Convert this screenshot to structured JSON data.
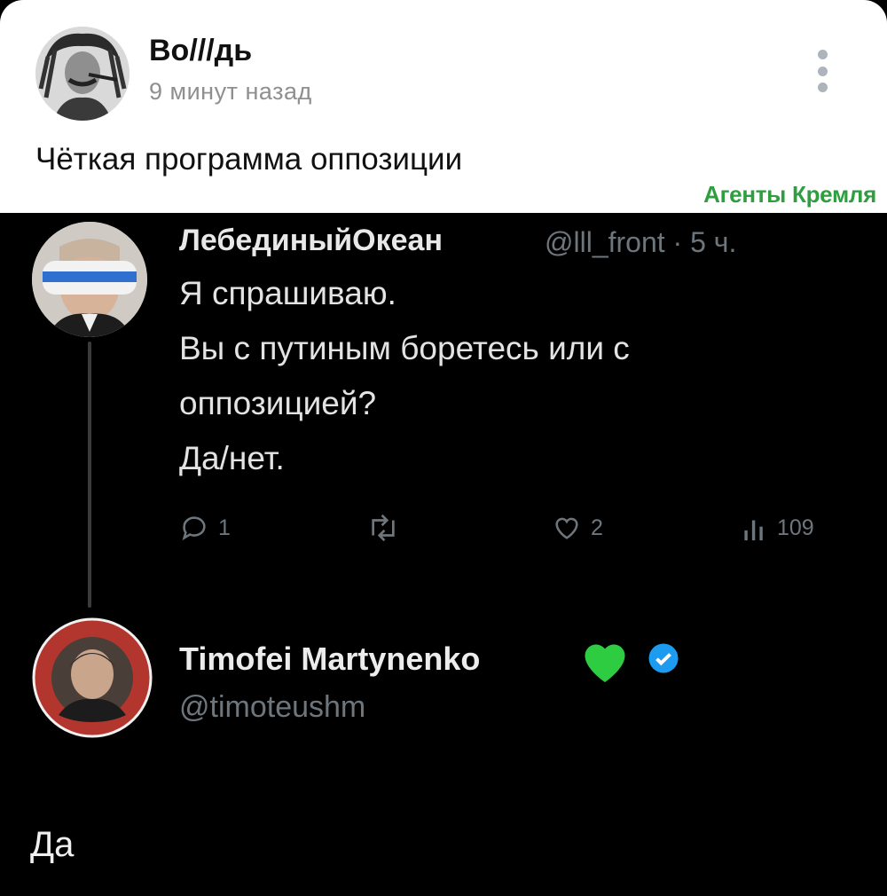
{
  "post": {
    "author": "Во///дь",
    "time": "9 минут назад",
    "text": "Чёткая программа оппозиции",
    "watermark": "Агенты Кремля",
    "menu_icon": "kebab-vertical-icon"
  },
  "tweet_original": {
    "display_name": "ЛебединыйОкеан",
    "meta": "@lll_front · 5 ч.",
    "lines": [
      "Я спрашиваю.",
      "Вы с путиным боретесь или с",
      "оппозицией?",
      "Да/нет."
    ],
    "stats": {
      "replies": "1",
      "likes": "2",
      "views": "109"
    }
  },
  "tweet_reply": {
    "display_name": "Timofei Martynenko",
    "handle": "@timoteushm",
    "text": "Да",
    "badge_colors": {
      "heart": "#2ecc40",
      "verified": "#1d9bf0"
    }
  }
}
